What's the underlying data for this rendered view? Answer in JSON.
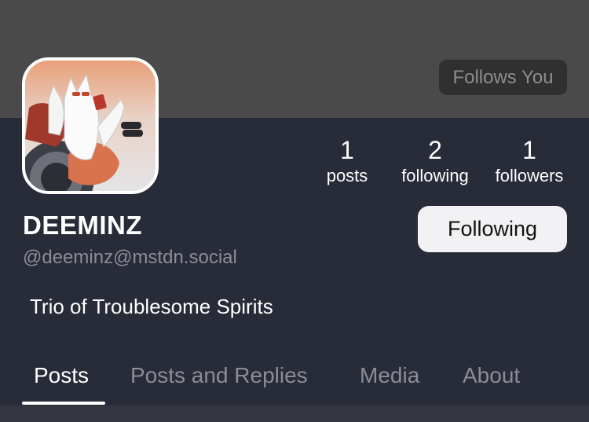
{
  "profile": {
    "follows_you_label": "Follows You",
    "display_name": "DEEMINZ",
    "handle": "@deeminz@mstdn.social",
    "bio": "Trio of Troublesome Spirits",
    "follow_button_label": "Following"
  },
  "stats": {
    "posts": {
      "value": "1",
      "label": "posts"
    },
    "following": {
      "value": "2",
      "label": "following"
    },
    "followers": {
      "value": "1",
      "label": "followers"
    }
  },
  "tabs": [
    {
      "label": "Posts",
      "active": true
    },
    {
      "label": "Posts and Replies",
      "active": false
    },
    {
      "label": "Media",
      "active": false
    },
    {
      "label": "About",
      "active": false
    }
  ],
  "colors": {
    "background": "#282b38",
    "banner": "#4a4a4a",
    "accent_text": "#ffffff",
    "muted_text": "#8b8d96"
  }
}
